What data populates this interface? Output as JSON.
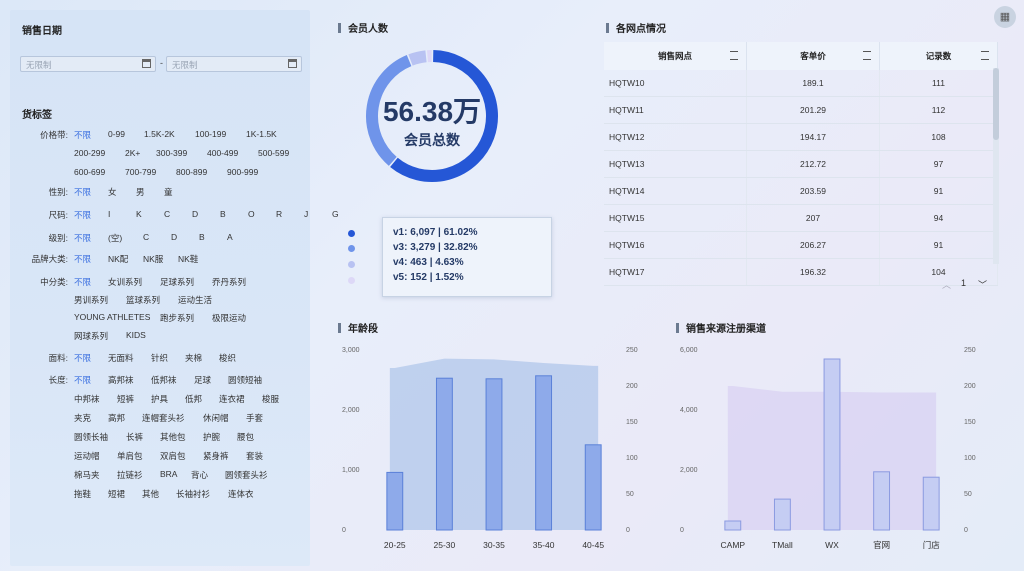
{
  "corner_icon": "grid-icon",
  "sales_date": {
    "title": "销售日期",
    "start_placeholder": "无限制",
    "end_placeholder": "无限制",
    "separator": "-"
  },
  "tags": {
    "title": "货标签",
    "groups": [
      {
        "label": "价格带:",
        "rows": [
          [
            "不限",
            "0-99",
            "1.5K-2K",
            "100-199",
            "1K-1.5K"
          ],
          [
            "200-299",
            "2K+",
            "300-399",
            "400-499",
            "500-599"
          ],
          [
            "600-699",
            "700-799",
            "800-899",
            "900-999"
          ]
        ]
      },
      {
        "label": "性别:",
        "rows": [
          [
            "不限",
            "女",
            "男",
            "童"
          ]
        ]
      },
      {
        "label": "尺码:",
        "rows": [
          [
            "不限",
            "I",
            "K",
            "C",
            "D",
            "B",
            "O",
            "R",
            "J",
            "G"
          ]
        ]
      },
      {
        "label": "级别:",
        "rows": [
          [
            "不限",
            "(空)",
            "C",
            "D",
            "B",
            "A"
          ]
        ]
      },
      {
        "label": "品牌大类:",
        "rows": [
          [
            "不限",
            "NK配",
            "NK服",
            "NK鞋"
          ]
        ]
      },
      {
        "label": "中分类:",
        "rows": [
          [
            "不限",
            "女训系列",
            "足球系列",
            "乔丹系列"
          ],
          [
            "男训系列",
            "篮球系列",
            "运动生活"
          ],
          [
            "YOUNG ATHLETES",
            "跑步系列",
            "极限运动"
          ],
          [
            "网球系列",
            "KIDS"
          ]
        ]
      },
      {
        "label": "面料:",
        "rows": [
          [
            "不限",
            "无面料",
            "针织",
            "夹棉",
            "梭织"
          ]
        ]
      },
      {
        "label": "长度:",
        "rows": [
          [
            "不限",
            "高邦袜",
            "低邦袜",
            "足球",
            "圆领短袖"
          ],
          [
            "中邦袜",
            "短裤",
            "护具",
            "低邦",
            "连衣裙",
            "梭服"
          ],
          [
            "夹克",
            "高邦",
            "连帽套头衫",
            "休闲帽",
            "手套"
          ],
          [
            "圆领长袖",
            "长裤",
            "其他包",
            "护腕",
            "腰包"
          ],
          [
            "运动帽",
            "单肩包",
            "双肩包",
            "紧身裤",
            "套装"
          ],
          [
            "棉马夹",
            "拉链衫",
            "BRA",
            "背心",
            "圆领套头衫"
          ],
          [
            "拖鞋",
            "短裙",
            "其他",
            "长袖衬衫",
            "连体衣"
          ]
        ]
      }
    ]
  },
  "members": {
    "title": "会员人数",
    "total_value": "56.38万",
    "total_label": "会员总数",
    "segments": [
      {
        "name": "v1",
        "value": 6097,
        "pct": 61.02,
        "color": "#2557d6"
      },
      {
        "name": "v3",
        "value": 3279,
        "pct": 32.82,
        "color": "#6f94ea"
      },
      {
        "name": "v4",
        "value": 463,
        "pct": 4.63,
        "color": "#b8c2f2"
      },
      {
        "name": "v5",
        "value": 152,
        "pct": 1.52,
        "color": "#ddd8f7"
      }
    ],
    "tooltip": [
      "v1:  6,097 |  61.02%",
      "v3:  3,279 |  32.82%",
      "v4:  463 |  4.63%",
      "v5:  152 |  1.52%"
    ]
  },
  "outlets": {
    "title": "各网点情况",
    "columns": [
      "销售网点",
      "客单价",
      "记录数"
    ],
    "rows": [
      [
        "HQTW10",
        "189.1",
        "111"
      ],
      [
        "HQTW11",
        "201.29",
        "112"
      ],
      [
        "HQTW12",
        "194.17",
        "108"
      ],
      [
        "HQTW13",
        "212.72",
        "97"
      ],
      [
        "HQTW14",
        "203.59",
        "91"
      ],
      [
        "HQTW15",
        "207",
        "94"
      ],
      [
        "HQTW16",
        "206.27",
        "91"
      ],
      [
        "HQTW17",
        "196.32",
        "104"
      ]
    ],
    "page": "1"
  },
  "chart_data": [
    {
      "type": "bar",
      "title": "年龄段",
      "categories": [
        "20-25",
        "25-30",
        "30-35",
        "35-40",
        "40-45"
      ],
      "series": [
        {
          "values": [
            960,
            2530,
            2520,
            2570,
            1420
          ]
        }
      ],
      "area_values": [
        225,
        238,
        237,
        232,
        228
      ],
      "ylim": [
        0,
        3000
      ],
      "yticks": [
        "3,000",
        "2,000",
        "1,000",
        "0"
      ],
      "y2lim": [
        0,
        250
      ],
      "y2ticks": [
        "250",
        "200",
        "150",
        "100",
        "50",
        "0"
      ]
    },
    {
      "type": "bar",
      "title": "销售来源注册渠道",
      "categories": [
        "CAMP",
        "TMall",
        "WX",
        "官网",
        "门店"
      ],
      "series": [
        {
          "values": [
            300,
            1030,
            5700,
            1940,
            1760
          ]
        }
      ],
      "area_values": [
        200,
        192,
        192,
        191,
        191
      ],
      "ylim": [
        0,
        6000
      ],
      "yticks": [
        "6,000",
        "4,000",
        "2,000",
        "0"
      ],
      "y2lim": [
        0,
        250
      ],
      "y2ticks": [
        "250",
        "200",
        "150",
        "100",
        "50",
        "0"
      ]
    }
  ]
}
